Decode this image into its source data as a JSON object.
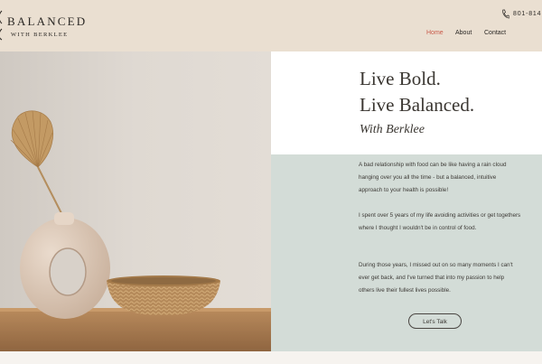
{
  "header": {
    "brand_title": "BALANCED",
    "brand_subtitle": "WITH BERKLEE",
    "phone": "801-814",
    "nav": [
      "Home",
      "About",
      "Contact"
    ]
  },
  "hero": {
    "headline_line1": "Live Bold.",
    "headline_line2": "Live Balanced.",
    "tagline": "With Berklee"
  },
  "content": {
    "paragraphs": [
      "A bad relationship with food can be like having a rain cloud hanging over you all the time - but a balanced, intuitive approach to your health is possible!",
      "I spent over 5 years of my life avoiding activities or get togethers where I thought I wouldn't be in control of food.",
      "During those years, I missed out on so many moments I can't ever get back, and I've turned that into my passion to help others live their fullest lives possible."
    ],
    "cta_label": "Let's Talk"
  },
  "colors": {
    "header_bg": "#eadfd1",
    "panel_bg": "#d3dcd7",
    "active_nav": "#c95a4a"
  }
}
